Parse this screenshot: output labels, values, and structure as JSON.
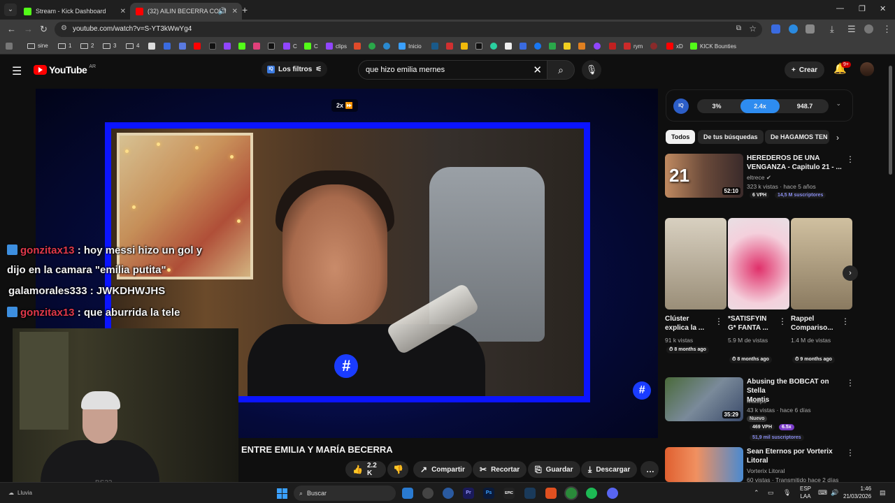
{
  "browser": {
    "tabs": [
      {
        "title": "Stream - Kick Dashboard",
        "fav_color": "#53fc18",
        "active": false
      },
      {
        "title": "(32) AILIN BECERRA CONTO",
        "fav_color": "#ff0000",
        "active": true
      }
    ],
    "url": "youtube.com/watch?v=S-YT3kWwYg4",
    "bookmarks": [
      {
        "label": "sine",
        "type": "folder"
      },
      {
        "label": "1",
        "type": "folder"
      },
      {
        "label": "2",
        "type": "folder"
      },
      {
        "label": "3",
        "type": "folder"
      },
      {
        "label": "4",
        "type": "folder"
      },
      {
        "label": "C",
        "type": "site",
        "color": "#9146ff"
      },
      {
        "label": "C",
        "type": "site",
        "color": "#53fc18"
      },
      {
        "label": "clips",
        "type": "site",
        "color": "#9146ff"
      },
      {
        "label": "Inicio",
        "type": "site",
        "color": "#3aa0ff"
      },
      {
        "label": "rym",
        "type": "site",
        "color": "#cc2a2a"
      },
      {
        "label": "xD",
        "type": "site",
        "color": "#ff0000"
      },
      {
        "label": "KICK Bounties",
        "type": "site",
        "color": "#53fc18"
      }
    ]
  },
  "youtube": {
    "logo_text": "YouTube",
    "country": "AR",
    "filters_label": "Los filtros",
    "search_query": "que hizo emilia mernes",
    "create_label": "Crear",
    "notif_count": "9+"
  },
  "player": {
    "speed_label": "2x",
    "title": "ENTRE EMILIA Y MARÍA BECERRA",
    "logo_glyph": "#"
  },
  "chat": [
    {
      "user": "gonzitax13",
      "user_color": "#e0384a",
      "message": ": hoy messi hizo un gol y",
      "cont": "dijo en la camara \"emilia putita\""
    },
    {
      "user": "galamorales333",
      "user_color": "#f2f2f2",
      "message": ": JWKDHWJHS"
    },
    {
      "user": "gonzitax13",
      "user_color": "#e0384a",
      "message": ": que aburrida la tele"
    }
  ],
  "webcam": {
    "shirt_text": "BS23"
  },
  "actions": {
    "likes": "2.2 K",
    "share": "Compartir",
    "clip": "Recortar",
    "save": "Guardar",
    "download": "Descargar"
  },
  "speed_extension": {
    "percent": "3%",
    "speed": "2.4x",
    "value": "948.7"
  },
  "chips": [
    "Todos",
    "De tus búsquedas",
    "De HAGAMOS TEN"
  ],
  "recommendations": [
    {
      "title_l1": "HEREDEROS DE UNA",
      "title_l2": "VENGANZA - Capitulo 21 - ...",
      "channel": "eltrece",
      "meta": "323 k vistas · hace 5 años",
      "duration": "52:10",
      "vph": "6 VPH",
      "subs": "14,5 M suscriptores"
    },
    {
      "title_l1": "Abusing the BOBCAT on Stella",
      "title_l2": "Montis",
      "channel": "Mattfps",
      "meta": "43 k vistas · hace 6 días",
      "duration": "35:29",
      "badge": "Nuevo",
      "vph": "469 VPH",
      "mult": "6.5x",
      "subs": "51,9 mil suscriptores"
    },
    {
      "title_l1": "Sean Eternos por Vorterix",
      "title_l2": "Litoral",
      "channel": "Vorterix Litoral",
      "meta": "60 vistas · Transmitido hace 2 días"
    }
  ],
  "shorts": [
    {
      "title_l1": "Clúster",
      "title_l2": "explica la ...",
      "views": "91 k vistas",
      "age": "8 months ago"
    },
    {
      "title_l1": "*SATISFYIN",
      "title_l2": "G* FANTA ...",
      "views": "5.9 M de vistas",
      "age": "8 months ago"
    },
    {
      "title_l1": "Rappel",
      "title_l2": "Compariso...",
      "views": "1.4 M de vistas",
      "age": "9 months ago"
    }
  ],
  "taskbar": {
    "weather": "Lluvia",
    "search": "Buscar",
    "lang_1": "ESP",
    "lang_2": "LAA",
    "time": "1:46",
    "date": "21/03/2026"
  }
}
